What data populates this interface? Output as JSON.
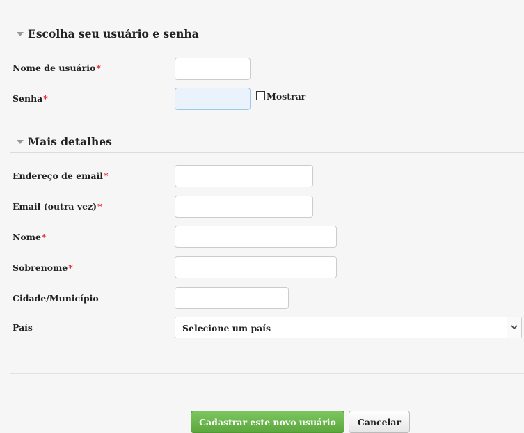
{
  "section1": {
    "title": "Escolha seu usuário e senha",
    "username_label": "Nome de usuário",
    "password_label": "Senha",
    "show_label": "Mostrar",
    "required_marker": "*"
  },
  "section2": {
    "title": "Mais detalhes",
    "email_label": "Endereço de email",
    "email2_label": "Email (outra vez)",
    "firstname_label": "Nome",
    "lastname_label": "Sobrenome",
    "city_label": "Cidade/Município",
    "country_label": "País",
    "country_value": "Selecione um país"
  },
  "buttons": {
    "submit_label": "Cadastrar este novo usuário",
    "cancel_label": "Cancelar"
  },
  "icons": {
    "collapse": "triangle-down-icon",
    "dropdown": "chevron-down-icon"
  }
}
